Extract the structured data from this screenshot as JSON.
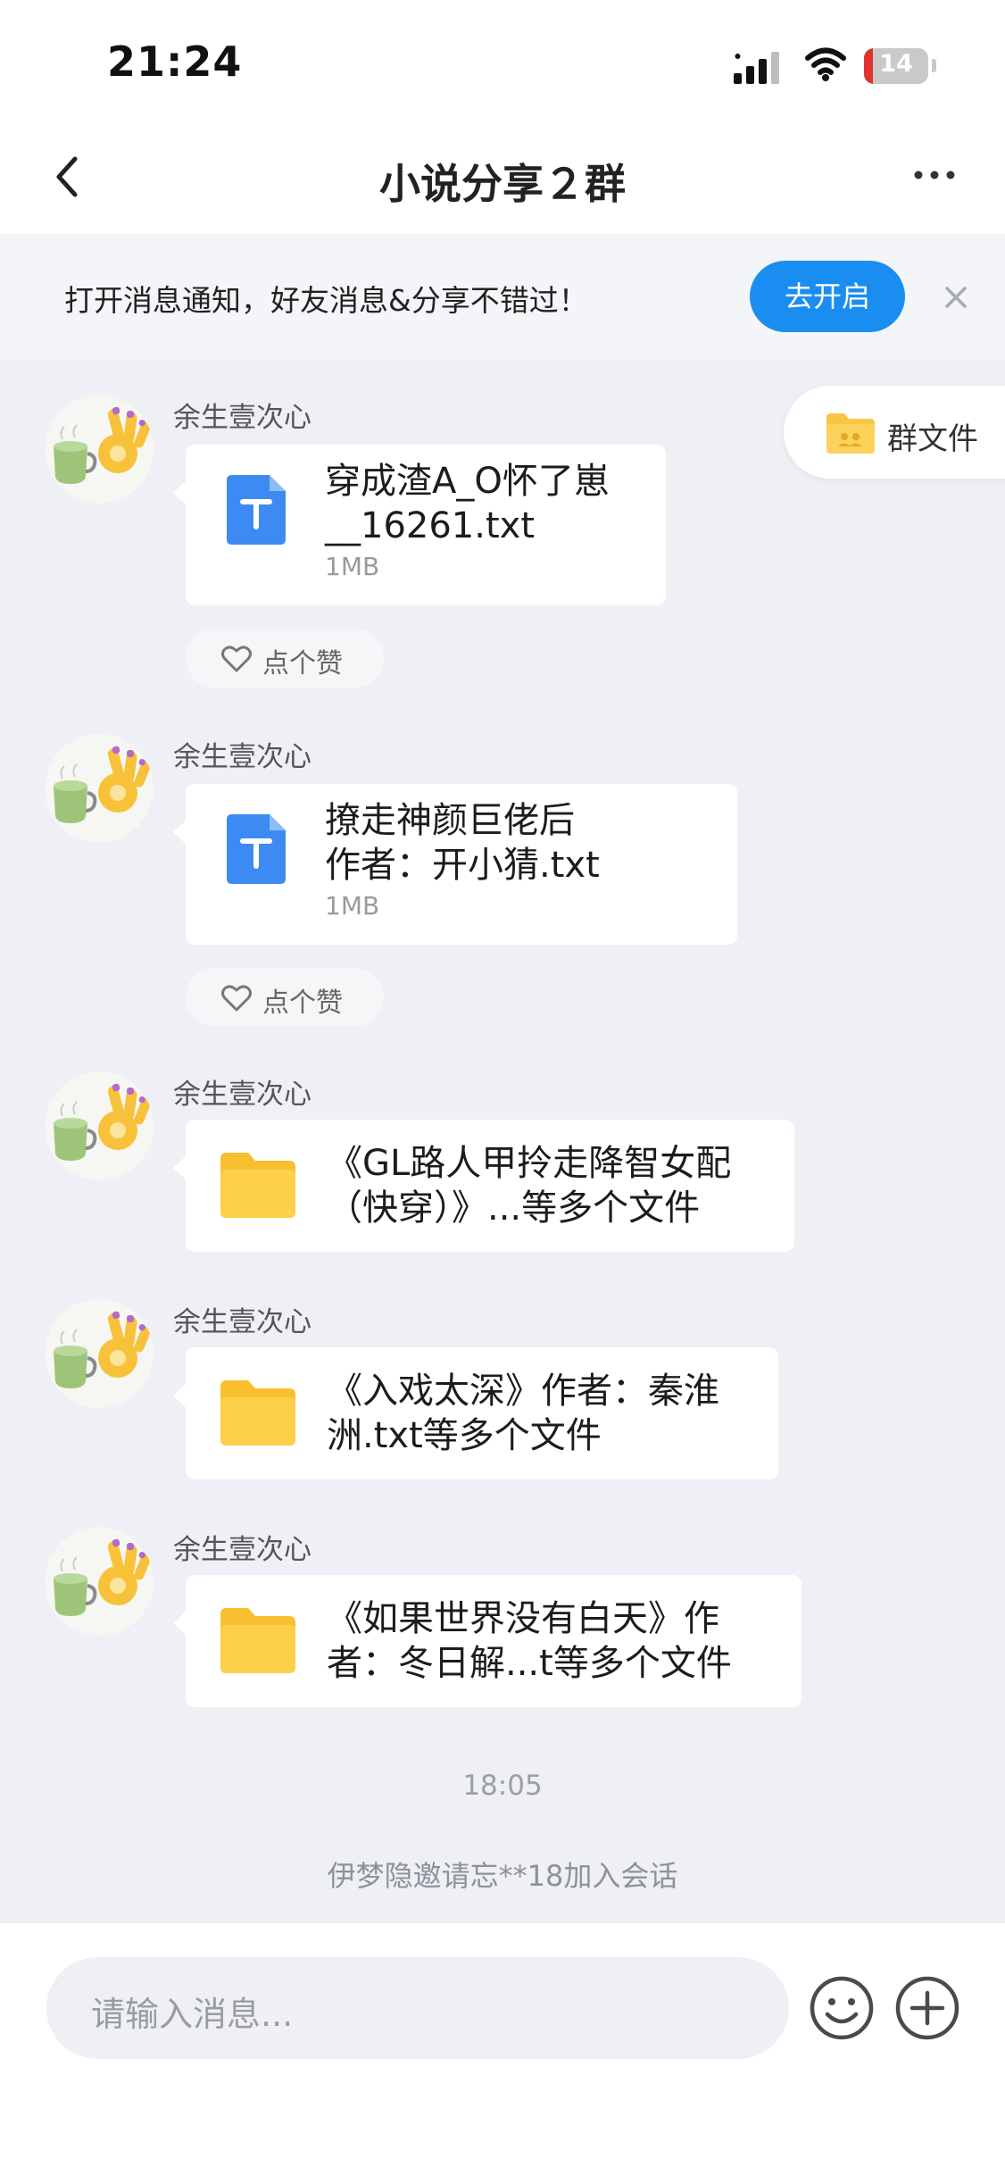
{
  "status_bar": {
    "time": "21:24",
    "battery_level": "14"
  },
  "nav": {
    "title": "小说分享２群"
  },
  "notice": {
    "text": "打开消息通知，好友消息&分享不错过！",
    "button_label": "去开启"
  },
  "group_files": {
    "label": "群文件"
  },
  "messages": [
    {
      "sender": "余生壹次心",
      "file_line1": "穿成渣A_O怀了崽",
      "file_line2": "__16261.txt",
      "file_size": "1MB",
      "like_label": "点个赞",
      "icon": "txt-file-icon"
    },
    {
      "sender": "余生壹次心",
      "file_line1": "撩走神颜巨佬后",
      "file_line2": "作者：开小猜.txt",
      "file_size": "1MB",
      "like_label": "点个赞",
      "icon": "txt-file-icon"
    },
    {
      "sender": "余生壹次心",
      "file_line1": "《GL路人甲拎走降智女配",
      "file_line2": "（快穿）》...等多个文件",
      "icon": "folder-icon"
    },
    {
      "sender": "余生壹次心",
      "file_line1": "《入戏太深》作者：秦淮",
      "file_line2": "洲.txt等多个文件",
      "icon": "folder-icon"
    },
    {
      "sender": "余生壹次心",
      "file_line1": "《如果世界没有白天》作",
      "file_line2": "者：冬日解...t等多个文件",
      "icon": "folder-icon"
    }
  ],
  "time_divider": "18:05",
  "system_message": "伊梦隐邀请忘**18加入会话",
  "input": {
    "placeholder": "请输入消息..."
  },
  "colors": {
    "accent": "#1a8ef0",
    "background": "#eef0f5",
    "battery_low": "#e0332e"
  }
}
